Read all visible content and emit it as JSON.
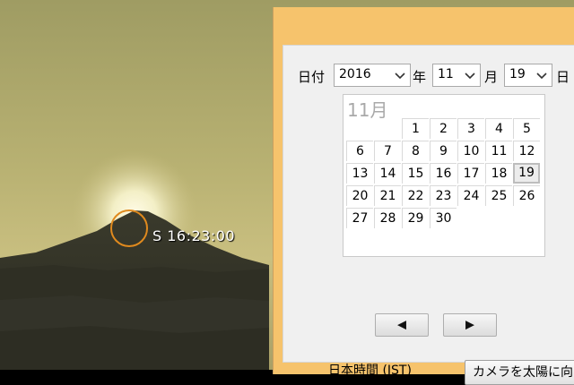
{
  "scene": {
    "sun_label": "S 16:23:00"
  },
  "form": {
    "date_label": "日付",
    "year": {
      "value": "2016",
      "suffix": "年"
    },
    "month": {
      "value": "11",
      "suffix": "月"
    },
    "day": {
      "value": "19",
      "suffix": "日"
    }
  },
  "calendar": {
    "month_title": "11月",
    "weeks": [
      [
        "",
        "",
        "1",
        "2",
        "3",
        "4",
        "5"
      ],
      [
        "6",
        "7",
        "8",
        "9",
        "10",
        "11",
        "12"
      ],
      [
        "13",
        "14",
        "15",
        "16",
        "17",
        "18",
        "19"
      ],
      [
        "20",
        "21",
        "22",
        "23",
        "24",
        "25",
        "26"
      ],
      [
        "27",
        "28",
        "29",
        "30",
        "",
        "",
        ""
      ]
    ],
    "selected_day": "19"
  },
  "nav": {
    "prev_icon": "◀",
    "next_icon": "▶"
  },
  "footer": {
    "timezone_label": "日本時間 (JST)",
    "camera_button_label": "カメラを太陽に向け"
  },
  "colors": {
    "panel_bg": "#f6c36c",
    "sky_top": "#a8a468",
    "sun_ring": "#e08a1e"
  }
}
